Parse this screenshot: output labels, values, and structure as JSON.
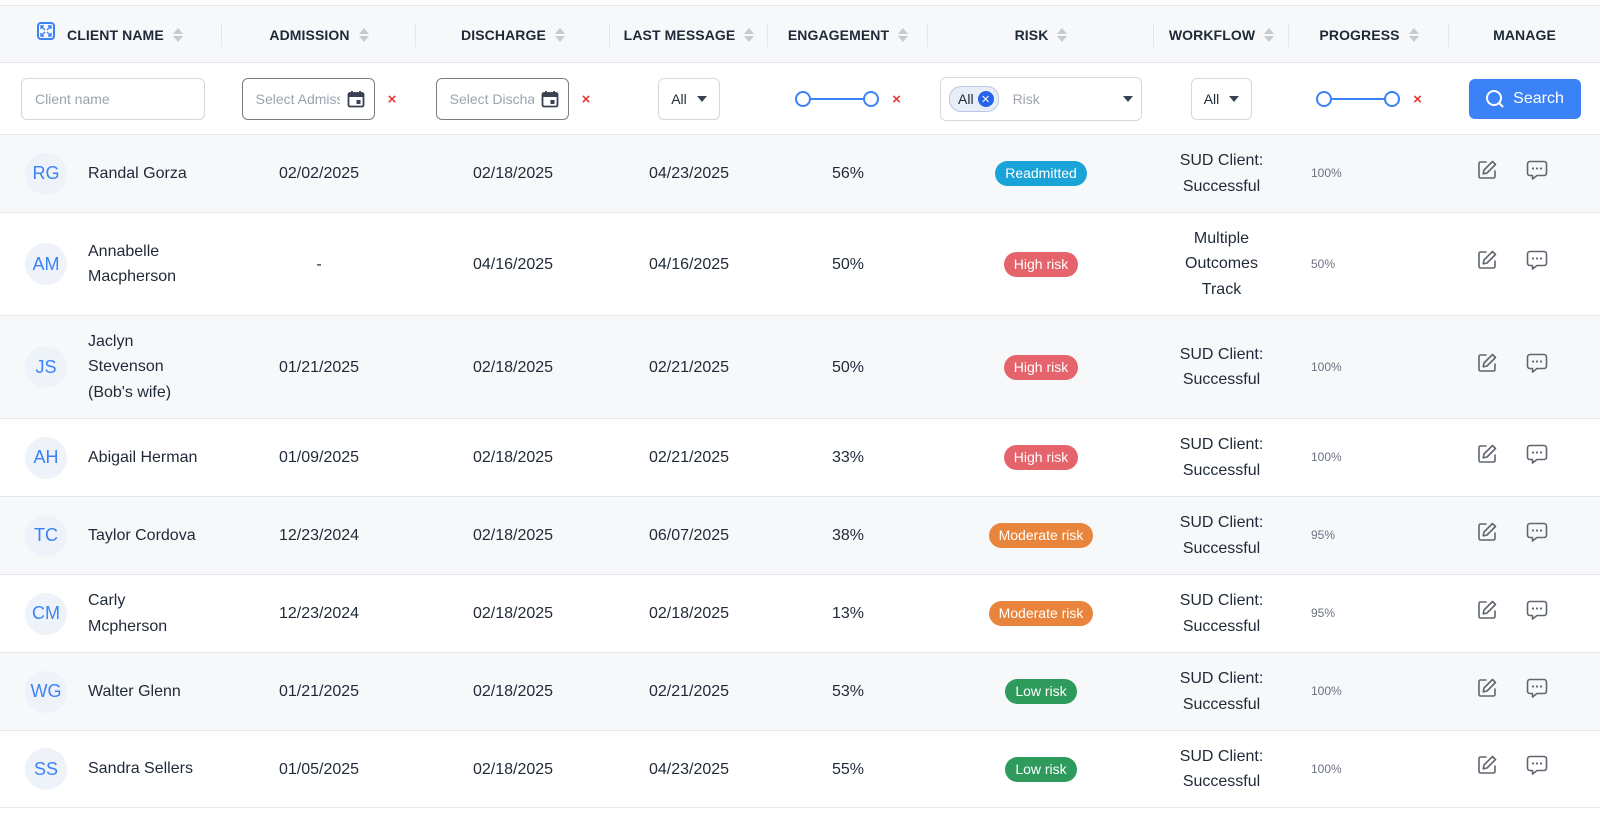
{
  "columns": {
    "client_name": "CLIENT NAME",
    "admission": "ADMISSION",
    "discharge": "DISCHARGE",
    "last_message": "LAST MESSAGE",
    "engagement": "ENGAGEMENT",
    "risk": "RISK",
    "workflow": "WORKFLOW",
    "progress": "PROGRESS",
    "manage": "MANAGE"
  },
  "filters": {
    "client_name_placeholder": "Client name",
    "admission_placeholder": "Select Admission",
    "discharge_placeholder": "Select Discharge",
    "last_message_value": "All",
    "risk_chip": "All",
    "risk_placeholder": "Risk",
    "workflow_value": "All",
    "clear_symbol": "×",
    "search_label": "Search"
  },
  "colors": {
    "accent": "#3b82f6",
    "readmitted": "#1aa3d6",
    "high_risk": "#e5636a",
    "moderate_risk": "#e8843c",
    "low_risk": "#2e9a5c",
    "clear": "#e53935"
  },
  "rows": [
    {
      "initials": "RG",
      "name": "Randal Gorza",
      "admission": "02/02/2025",
      "discharge": "02/18/2025",
      "last_message": "04/23/2025",
      "engagement": "56%",
      "risk": "Readmitted",
      "risk_color": "#1aa3d6",
      "workflow": "SUD Client: Successful",
      "progress": "100%"
    },
    {
      "initials": "AM",
      "name": "Annabelle Macpherson",
      "admission": "-",
      "discharge": "04/16/2025",
      "last_message": "04/16/2025",
      "engagement": "50%",
      "risk": "High risk",
      "risk_color": "#e5636a",
      "workflow": "Multiple Outcomes Track",
      "progress": "50%"
    },
    {
      "initials": "JS",
      "name": "Jaclyn Stevenson (Bob's wife)",
      "admission": "01/21/2025",
      "discharge": "02/18/2025",
      "last_message": "02/21/2025",
      "engagement": "50%",
      "risk": "High risk",
      "risk_color": "#e5636a",
      "workflow": "SUD Client: Successful",
      "progress": "100%"
    },
    {
      "initials": "AH",
      "name": "Abigail Herman",
      "admission": "01/09/2025",
      "discharge": "02/18/2025",
      "last_message": "02/21/2025",
      "engagement": "33%",
      "risk": "High risk",
      "risk_color": "#e5636a",
      "workflow": "SUD Client: Successful",
      "progress": "100%"
    },
    {
      "initials": "TC",
      "name": "Taylor Cordova",
      "admission": "12/23/2024",
      "discharge": "02/18/2025",
      "last_message": "06/07/2025",
      "engagement": "38%",
      "risk": "Moderate risk",
      "risk_color": "#e8843c",
      "workflow": "SUD Client: Successful",
      "progress": "95%"
    },
    {
      "initials": "CM",
      "name": "Carly Mcpherson",
      "admission": "12/23/2024",
      "discharge": "02/18/2025",
      "last_message": "02/18/2025",
      "engagement": "13%",
      "risk": "Moderate risk",
      "risk_color": "#e8843c",
      "workflow": "SUD Client: Successful",
      "progress": "95%"
    },
    {
      "initials": "WG",
      "name": "Walter Glenn",
      "admission": "01/21/2025",
      "discharge": "02/18/2025",
      "last_message": "02/21/2025",
      "engagement": "53%",
      "risk": "Low risk",
      "risk_color": "#2e9a5c",
      "workflow": "SUD Client: Successful",
      "progress": "100%"
    },
    {
      "initials": "SS",
      "name": "Sandra Sellers",
      "admission": "01/05/2025",
      "discharge": "02/18/2025",
      "last_message": "04/23/2025",
      "engagement": "55%",
      "risk": "Low risk",
      "risk_color": "#2e9a5c",
      "workflow": "SUD Client: Successful",
      "progress": "100%"
    }
  ]
}
